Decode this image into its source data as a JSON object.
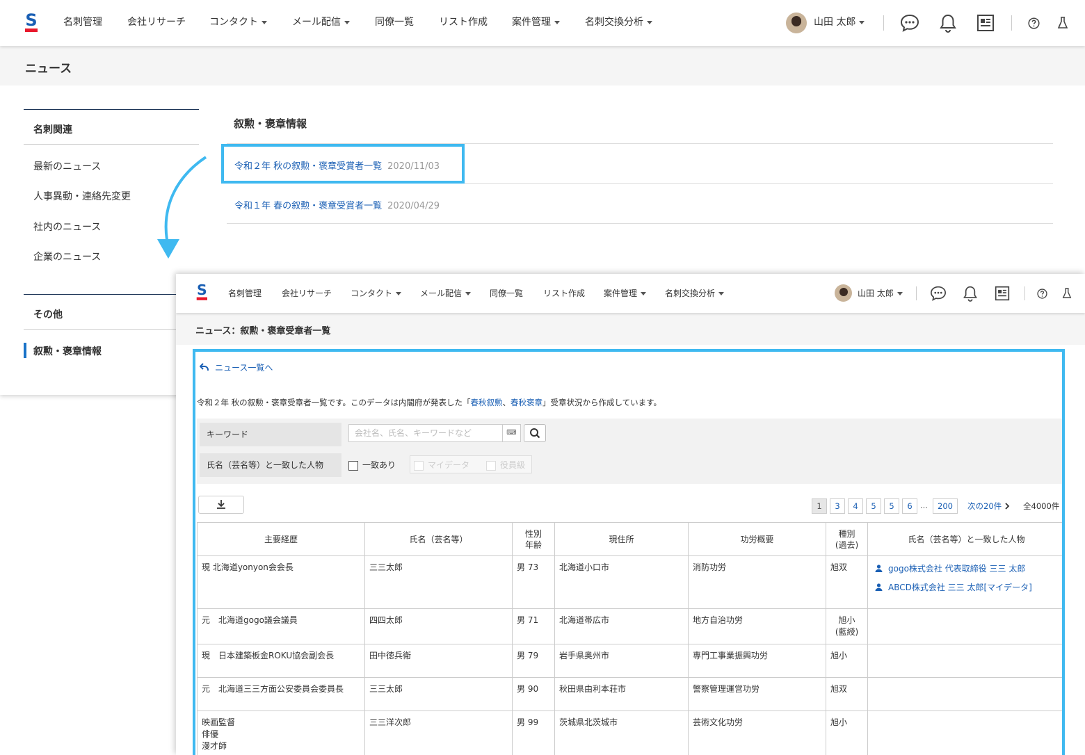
{
  "nav": {
    "items": [
      {
        "label": "名刺管理",
        "dropdown": false
      },
      {
        "label": "会社リサーチ",
        "dropdown": false
      },
      {
        "label": "コンタクト",
        "dropdown": true
      },
      {
        "label": "メール配信",
        "dropdown": true
      },
      {
        "label": "同僚一覧",
        "dropdown": false
      },
      {
        "label": "リスト作成",
        "dropdown": false
      },
      {
        "label": "案件管理",
        "dropdown": true
      },
      {
        "label": "名刺交換分析",
        "dropdown": true
      }
    ],
    "user_name": "山田 太郎",
    "logo_letter": "S"
  },
  "back_page": {
    "title": "ニュース",
    "sidebar": {
      "section1_title": "名刺関連",
      "section1_items": [
        "最新のニュース",
        "人事異動・連絡先変更",
        "社内のニュース",
        "企業のニュース"
      ],
      "section2_title": "その他",
      "section2_items": [
        "叙勲・褒章情報"
      ]
    },
    "content_title": "叙勲・褒章情報",
    "news": [
      {
        "title": "令和２年 秋の叙勲・褒章受賞者一覧",
        "date": "2020/11/03"
      },
      {
        "title": "令和１年 春の叙勲・褒章受賞者一覧",
        "date": "2020/04/29"
      }
    ]
  },
  "front_page": {
    "title": "ニュース：叙勲・褒章受章者一覧",
    "back_link": "ニュース一覧へ",
    "desc_before": "令和２年 秋の叙勲・褒章受章者一覧です。このデータは内閣府が発表した「",
    "desc_link1": "春秋叙勲",
    "desc_sep": "、",
    "desc_link2": "春秋褒章",
    "desc_after": "」受章状況から作成しています。",
    "search": {
      "keyword_label": "キーワード",
      "keyword_placeholder": "会社名、氏名、キーワードなど",
      "match_label": "氏名（芸名等）と一致した人物",
      "match_option": "一致あり",
      "mydata_option": "マイデータ",
      "executive_option": "役員級"
    },
    "pager": {
      "pages": [
        "1",
        "3",
        "4",
        "5",
        "5",
        "6"
      ],
      "ellipsis": "...",
      "last": "200",
      "next": "次の20件",
      "total": "全4000件"
    },
    "table": {
      "headers": [
        "主要経歴",
        "氏名（芸名等）",
        "性別\n年齢",
        "現住所",
        "功労概要",
        "種別\n(過去)",
        "氏名（芸名等）と一致した人物"
      ],
      "rows": [
        {
          "career": "現 北海道yonyon会会長",
          "name": "三三太郎",
          "sex_age": "男 73",
          "address": "北海道小口市",
          "merit": "消防功労",
          "type": "旭双",
          "matches": [
            "gogo株式会社 代表取締役 三三 太郎",
            "ABCD株式会社 三三 太郎[マイデータ]"
          ]
        },
        {
          "career": "元　北海道gogo議会議員",
          "name": "四四太郎",
          "sex_age": "男 71",
          "address": "北海道帯広市",
          "merit": "地方自治功労",
          "type": "旭小\n(藍綬)",
          "matches": []
        },
        {
          "career": "現　日本建築板金ROKU協会副会長",
          "name": "田中徳兵衛",
          "sex_age": "男 79",
          "address": "岩手県奥州市",
          "merit": "専門工事業振興功労",
          "type": "旭小",
          "matches": []
        },
        {
          "career": "元　北海道三三方面公安委員会委員長",
          "name": "三三太郎",
          "sex_age": "男 90",
          "address": "秋田県由利本荘市",
          "merit": "警察管理運営功労",
          "type": "旭双",
          "matches": []
        },
        {
          "career": "映画監督\n俳優\n漫才師",
          "name": "三三洋次郎",
          "sex_age": "男 99",
          "address": "茨城県北茨城市",
          "merit": "芸術文化功労",
          "type": "旭小",
          "matches": []
        }
      ]
    }
  },
  "colors": {
    "accent_blue": "#3fb9f0",
    "link": "#1a5fb4",
    "logo_red": "#e8182c"
  }
}
